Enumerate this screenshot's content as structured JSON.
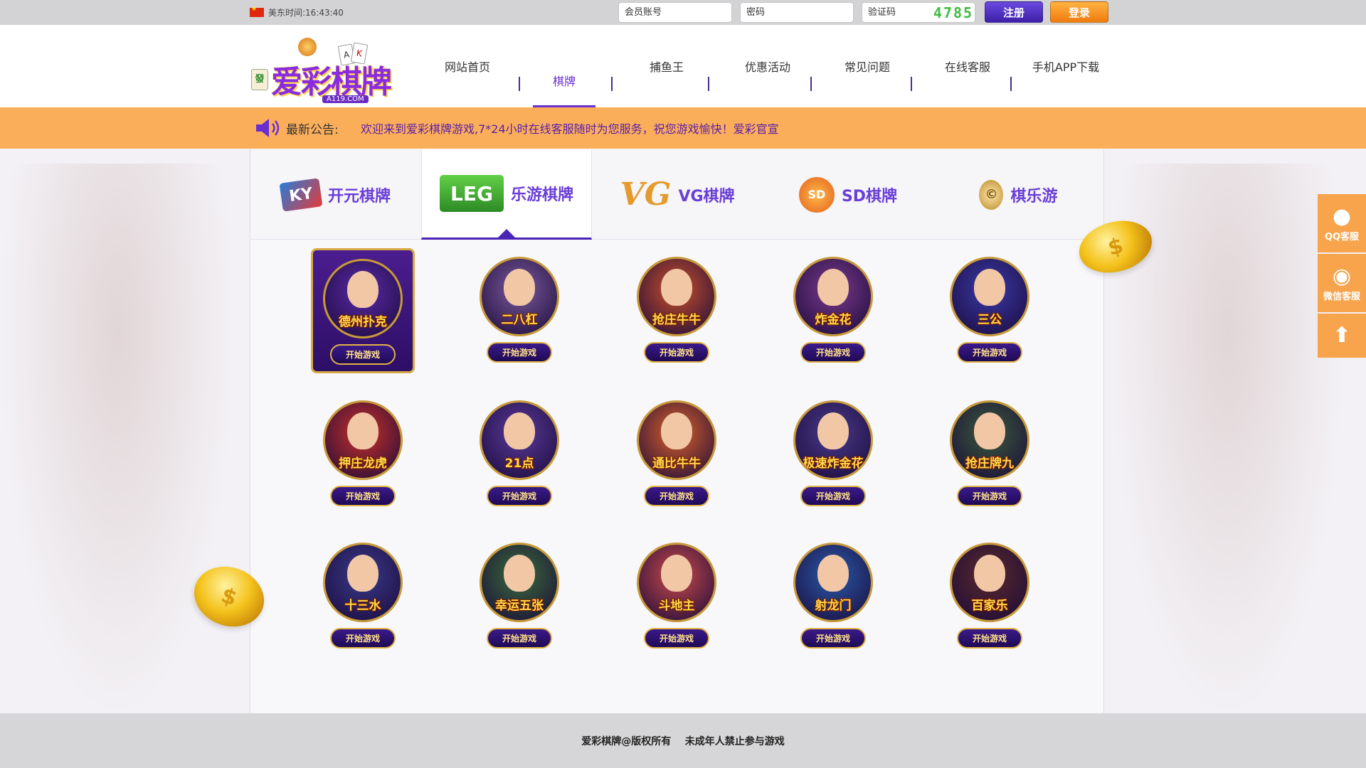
{
  "topbar": {
    "time_text": "美东时间:16:43:40",
    "account_placeholder": "会员账号",
    "password_placeholder": "密码",
    "captcha_placeholder": "验证码",
    "captcha_code": "4785",
    "register_label": "注册",
    "login_label": "登录"
  },
  "logo": {
    "text": "爱彩棋牌",
    "domain": "A119.COM",
    "tile": "發",
    "card1": "A",
    "card2": "K"
  },
  "nav": {
    "items": [
      {
        "label": "网站首页"
      },
      {
        "label": "棋牌"
      },
      {
        "label": "捕鱼王"
      },
      {
        "label": "优惠活动"
      },
      {
        "label": "常见问题"
      },
      {
        "label": "在线客服"
      },
      {
        "label": "手机APP下载"
      }
    ]
  },
  "notice": {
    "label": "最新公告:",
    "text": "欢迎来到爱彩棋牌游戏,7*24小时在线客服随时为您服务，祝您游戏愉快！爱彩官宣"
  },
  "providers": [
    {
      "badge": "KY",
      "name": "开元棋牌"
    },
    {
      "badge": "LEG",
      "name": "乐游棋牌"
    },
    {
      "badge": "VG",
      "name": "VG棋牌"
    },
    {
      "badge": "SD",
      "name": "SD棋牌"
    },
    {
      "badge": "©",
      "name": "棋乐游"
    }
  ],
  "games": [
    {
      "title": "德州扑克",
      "button": "开始游戏",
      "color": "#5a2aa8"
    },
    {
      "title": "二八杠",
      "button": "开始游戏",
      "color": "#7b5a9a"
    },
    {
      "title": "抢庄牛牛",
      "button": "开始游戏",
      "color": "#c8502a"
    },
    {
      "title": "炸金花",
      "button": "开始游戏",
      "color": "#7a3a8a"
    },
    {
      "title": "三公",
      "button": "开始游戏",
      "color": "#3a3aa8"
    },
    {
      "title": "押庄龙虎",
      "button": "开始游戏",
      "color": "#c8302a"
    },
    {
      "title": "21点",
      "button": "开始游戏",
      "color": "#5a3a9a"
    },
    {
      "title": "通比牛牛",
      "button": "开始游戏",
      "color": "#d8602a"
    },
    {
      "title": "极速炸金花",
      "button": "开始游戏",
      "color": "#4a3a8a"
    },
    {
      "title": "抢庄牌九",
      "button": "开始游戏",
      "color": "#3a5a3a"
    },
    {
      "title": "十三水",
      "button": "开始游戏",
      "color": "#3a3a8a"
    },
    {
      "title": "幸运五张",
      "button": "开始游戏",
      "color": "#3a6a3a"
    },
    {
      "title": "斗地主",
      "button": "开始游戏",
      "color": "#c84a4a"
    },
    {
      "title": "射龙门",
      "button": "开始游戏",
      "color": "#2a5aa8"
    },
    {
      "title": "百家乐",
      "button": "开始游戏",
      "color": "#5a2a2a"
    }
  ],
  "float": {
    "qq_label": "QQ客服",
    "wechat_label": "微信客服",
    "qq_icon": "qq-penguin-icon",
    "wechat_icon": "wechat-chat-icon",
    "top_icon": "arrow-up-icon"
  },
  "footer": {
    "text": "爱彩棋牌@版权所有    未成年人禁止参与游戏"
  },
  "colors": {
    "accent": "#6a2fd0",
    "notice_bg": "#fbae5a",
    "float_bg": "#f7a44c"
  }
}
